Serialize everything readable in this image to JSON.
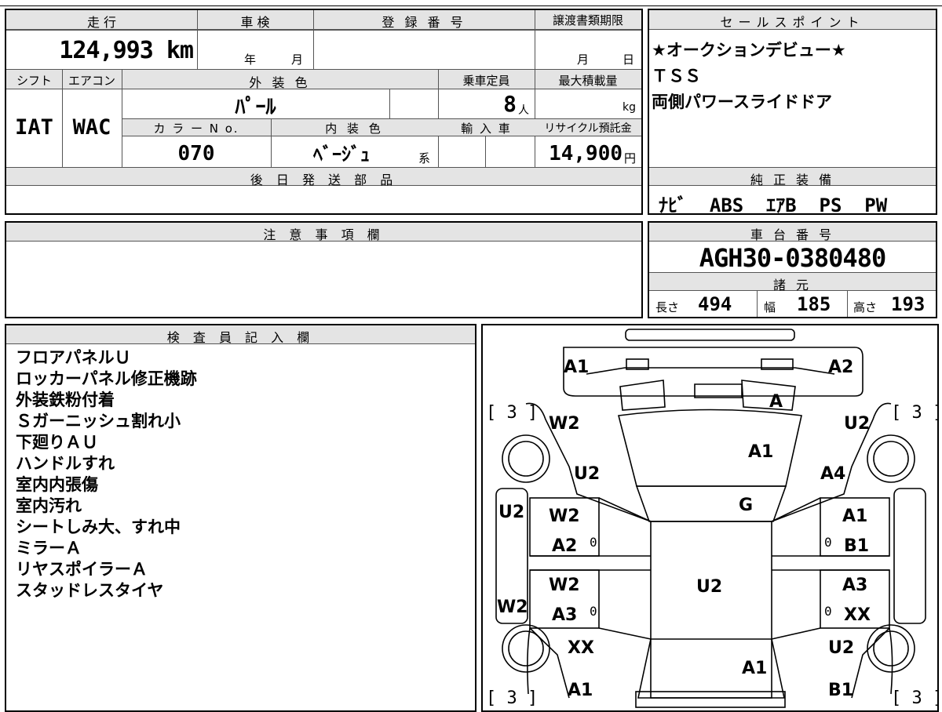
{
  "vehicle": {
    "labels": {
      "mileage": "走 行",
      "inspection": "車 検",
      "registration": "登 録 番 号",
      "transfer_deadline": "譲渡書類期限",
      "shift": "シフト",
      "aircon": "エアコン",
      "exterior_color": "外 装 色",
      "capacity": "乗車定員",
      "max_load": "最大積載量",
      "color_no": "カ ラ ー N o.",
      "interior_color": "内 装 色",
      "import": "輸 入 車",
      "recycle_fee": "リサイクル預託金",
      "later_parts": "後 日 発 送 部 品"
    },
    "mileage": "124,993 km",
    "inspection_year_unit": "年",
    "inspection_month_unit": "月",
    "transfer_month_unit": "月",
    "transfer_day_unit": "日",
    "shift": "IAT",
    "aircon": "WAC",
    "exterior_color": "ﾊﾟｰﾙ",
    "capacity": "8",
    "capacity_unit": "人",
    "max_load_unit": "kg",
    "color_no": "070",
    "interior_color": "ﾍﾞｰｼﾞｭ",
    "interior_color_suffix": "系",
    "recycle_fee": "14,900",
    "recycle_fee_unit": "円"
  },
  "sales_points": {
    "header": "セールスポイント",
    "lines": [
      "★オークションデビュー★",
      "ＴＳＳ",
      "両側パワースライドドア"
    ]
  },
  "equipment": {
    "header": "純 正 装 備",
    "value": "ﾅﾋﾞ  ABS  ｴｱB  PS  PW"
  },
  "caution": {
    "header": "注 意 事 項 欄"
  },
  "chassis": {
    "header": "車 台 番 号",
    "number": "AGH30-0380480",
    "specs_header": "諸 元",
    "length_label": "長さ",
    "length": "494",
    "width_label": "幅",
    "width": "185",
    "height_label": "高さ",
    "height": "193"
  },
  "inspector": {
    "header": "検 査 員 記 入 欄",
    "notes": [
      "フロアパネルＵ",
      "ロッカーパネル修正機跡",
      "外装鉄粉付着",
      "Ｓガーニッシュ割れ小",
      "下廻りＡＵ",
      "ハンドルすれ",
      "室内内張傷",
      "室内汚れ",
      "シートしみ大、すれ中",
      "ミラーＡ",
      "リヤスポイラーＡ",
      "スタッドレスタイヤ"
    ]
  },
  "diagram": {
    "front_left": "A1",
    "front_right": "A2",
    "windshield_mark": "A",
    "hood": "A1",
    "front_fender_left_top": "W2",
    "front_fender_left": "U2",
    "front_fender_right_top": "U2",
    "front_fender_right": "A4",
    "roof_front": "G",
    "left_side_skirt": "U2",
    "left_front_door_a": "W2",
    "left_front_door_b": "A2",
    "left_front_door_c": "0",
    "right_front_door_a": "A1",
    "right_front_door_b": "B1",
    "right_front_door_c": "0",
    "roof": "U2",
    "left_rear_door_a": "W2",
    "left_rear_door_b": "A3",
    "left_rear_door_c": "0",
    "right_rear_door_a": "A3",
    "right_rear_door_b": "XX",
    "right_rear_door_c": "0",
    "left_rear_side": "W2",
    "rear_quarter_left": "XX",
    "rear_quarter_right": "U2",
    "rear_gate": "A1",
    "rear_left": "A1",
    "rear_right": "B1",
    "tire_front_left": "[ 3 ]",
    "tire_front_right": "[ 3 ]",
    "tire_rear_left": "[ 3 ]",
    "tire_rear_right": "[ 3 ]"
  }
}
